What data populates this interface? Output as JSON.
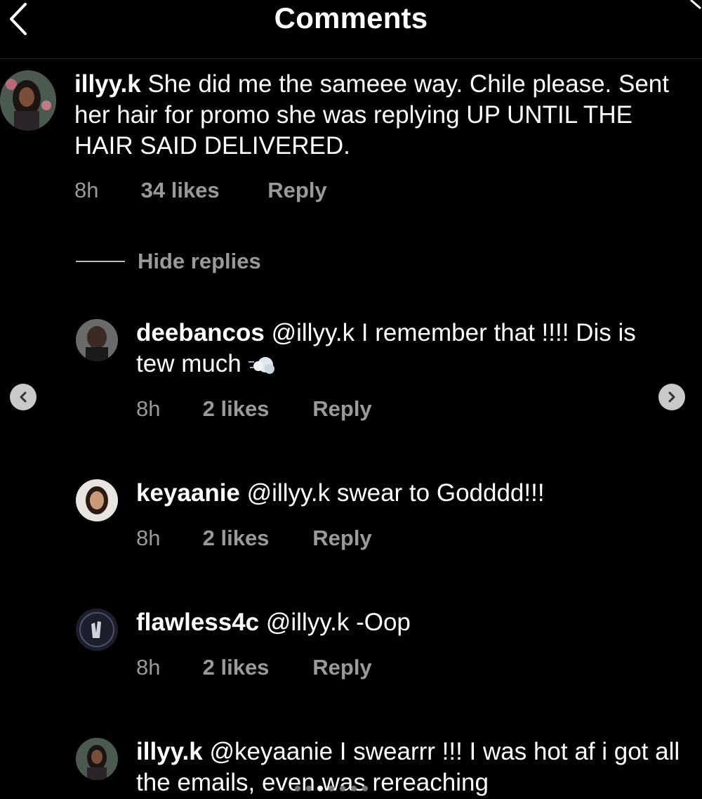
{
  "header": {
    "title": "Comments",
    "back_icon": "chevron-left-icon"
  },
  "main_comment": {
    "username": "illyy.k",
    "text": "She did me the sameee way. Chile please. Sent her hair for promo she was replying UP UNTIL THE HAIR SAID DELIVERED.",
    "time": "8h",
    "likes": "34 likes",
    "reply": "Reply"
  },
  "hide_replies": "Hide replies",
  "replies": [
    {
      "username": "deebancos",
      "text": "@illyy.k I remember that !!!! Dis is tew much",
      "emoji_icon": "dash-emoji-icon",
      "time": "8h",
      "likes": "2 likes",
      "reply": "Reply"
    },
    {
      "username": "keyaanie",
      "text": "@illyy.k swear to Godddd!!!",
      "time": "8h",
      "likes": "2 likes",
      "reply": "Reply"
    },
    {
      "username": "flawless4c",
      "text": "@illyy.k -Oop",
      "time": "8h",
      "likes": "2 likes",
      "reply": "Reply"
    },
    {
      "username": "illyy.k",
      "text": "@keyaanie I swearrr !!! I was hot af i got all the emails, even was rereaching",
      "time": "",
      "likes": "",
      "reply": ""
    }
  ],
  "carousel": {
    "prev_icon": "chevron-left-icon",
    "next_icon": "chevron-right-icon",
    "dot_count": 7,
    "active_dot": 2
  },
  "colors": {
    "background": "#000000",
    "text": "#ffffff",
    "secondary_text": "#9a9a9a",
    "nav_button": "#c9c9c9"
  }
}
